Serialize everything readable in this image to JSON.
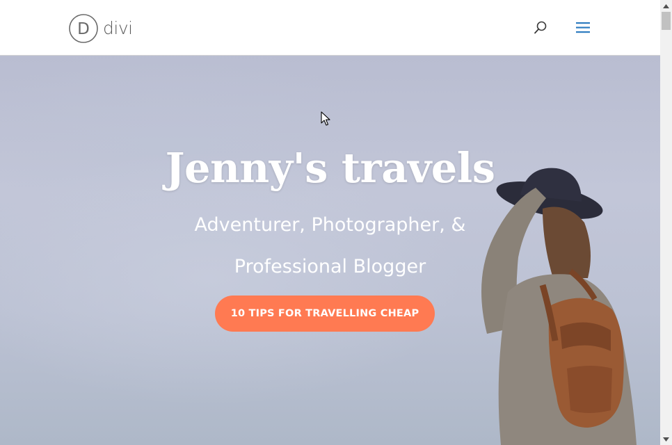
{
  "header": {
    "logo_text": "divi",
    "logo_letter": "D",
    "search_icon": "search-icon",
    "menu_icon": "hamburger-menu-icon"
  },
  "hero": {
    "title": "Jenny's travels",
    "subtitle_line1": "Adventurer, Photographer, &",
    "subtitle_line2": "Professional Blogger",
    "cta_label": "10 TIPS FOR TRAVELLING CHEAP"
  },
  "colors": {
    "accent": "#ff7a52",
    "menu_blue": "#2e7cc0",
    "logo_gray": "#5b5b5b",
    "hero_text": "#ffffff"
  }
}
